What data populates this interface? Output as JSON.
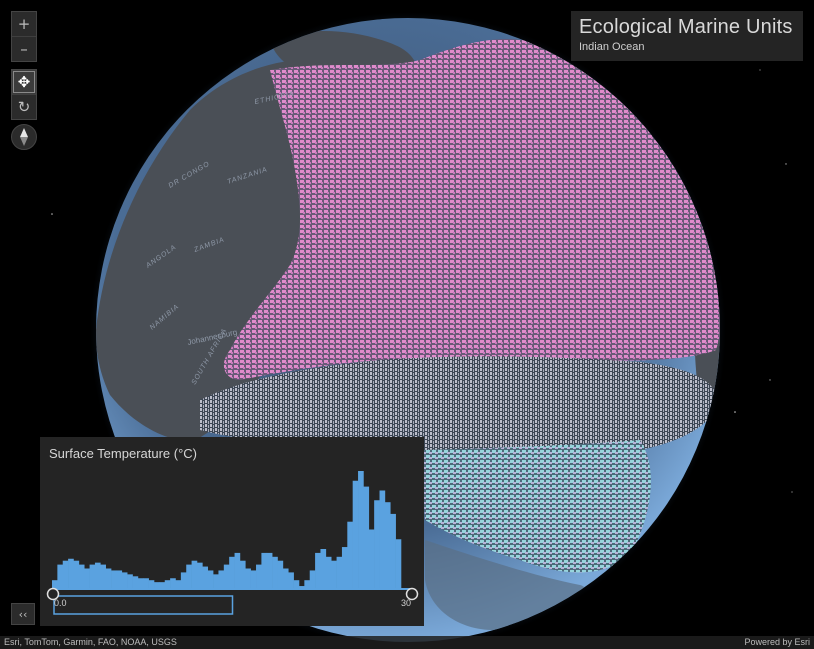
{
  "header": {
    "title": "Ecological Marine Units",
    "subtitle": "Indian Ocean"
  },
  "controls": {
    "zoom_in": "+",
    "zoom_out": "–",
    "pan": "✥",
    "rotate": "↻",
    "collapse": "‹‹",
    "active_mode": "pan"
  },
  "map_labels": [
    {
      "text": "ETHIOPIA"
    },
    {
      "text": "TANZANIA"
    },
    {
      "text": "ZAMBIA"
    },
    {
      "text": "ANGOLA"
    },
    {
      "text": "NAMIBIA"
    },
    {
      "text": "Johannesburg"
    },
    {
      "text": "SOUTH AFRICA"
    },
    {
      "text": "DR CONGO"
    }
  ],
  "histogram": {
    "title": "Surface Temperature (°C)",
    "min_label": "0.0",
    "max_label": "30",
    "range": [
      0,
      30
    ],
    "selected_range": [
      0,
      15
    ],
    "bar_color": "#5aa2e0",
    "bins": [
      4,
      12,
      14,
      15,
      14,
      12,
      10,
      12,
      13,
      12,
      10,
      9,
      9,
      8,
      7,
      6,
      5,
      5,
      4,
      3,
      3,
      4,
      5,
      4,
      8,
      12,
      14,
      13,
      11,
      9,
      7,
      9,
      12,
      16,
      18,
      14,
      10,
      9,
      12,
      18,
      18,
      16,
      14,
      10,
      8,
      4,
      1,
      4,
      9,
      18,
      20,
      16,
      14,
      16,
      21,
      34,
      55,
      60,
      52,
      30,
      45,
      50,
      44,
      38,
      25
    ],
    "ymax": 60
  },
  "attribution": {
    "left": "Esri, TomTom, Garmin, FAO, NOAA, USGS",
    "right": "Powered by Esri"
  },
  "colors": {
    "ocean_warm": "#d47fc0",
    "ocean_mid": "#c8c4d6",
    "ocean_cool": "#8ec9d4",
    "land": "#4a4f56",
    "globe_edge": "#5c87b8",
    "panel_bg": "#242424"
  }
}
